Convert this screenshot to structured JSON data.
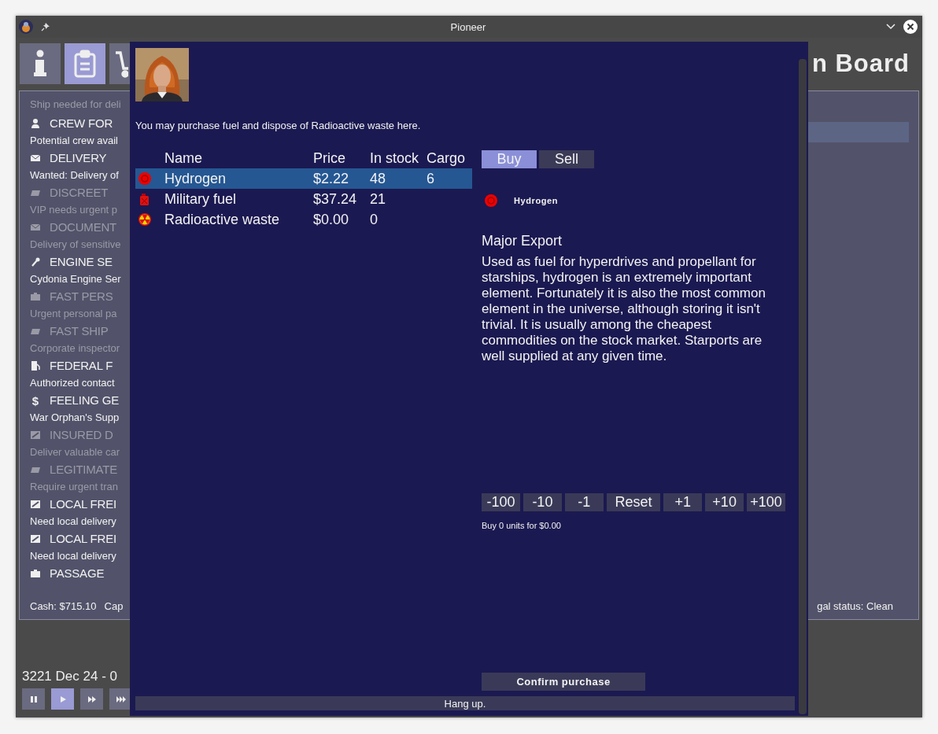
{
  "window": {
    "title": "Pioneer"
  },
  "toolbar": {
    "tabs": [
      {
        "kind": "info",
        "selected": false
      },
      {
        "kind": "clipboard",
        "selected": true
      },
      {
        "kind": "cart",
        "selected": false
      }
    ],
    "title": "n Board"
  },
  "board": {
    "intro": "Ship needed for deli",
    "items": [
      {
        "kind": "person",
        "title": "CREW FOR",
        "description": "Potential crew avail",
        "dimmed": false
      },
      {
        "kind": "mail",
        "title": "DELIVERY",
        "description": "Wanted: Delivery of",
        "dimmed": false
      },
      {
        "kind": "cargo",
        "title": "DISCREET",
        "description": "VIP needs urgent p",
        "dimmed": true
      },
      {
        "kind": "mail",
        "title": "DOCUMENT",
        "description": "Delivery of sensitive",
        "dimmed": true
      },
      {
        "kind": "wrench",
        "title": "ENGINE SE",
        "description": "Cydonia Engine Ser",
        "dimmed": false
      },
      {
        "kind": "briefcase",
        "title": "FAST PERS",
        "description": "Urgent personal pa",
        "dimmed": true
      },
      {
        "kind": "cargo",
        "title": "FAST SHIP",
        "description": "Corporate inspector",
        "dimmed": true
      },
      {
        "kind": "fuel",
        "title": "FEDERAL F",
        "description": "Authorized contact",
        "dimmed": false
      },
      {
        "kind": "glyph",
        "glyph": "$",
        "title": "FEELING GE",
        "description": "War Orphan's Supp",
        "dimmed": false
      },
      {
        "kind": "parcel",
        "title": "INSURED D",
        "description": "Deliver valuable car",
        "dimmed": true
      },
      {
        "kind": "cargo",
        "title": "LEGITIMATE",
        "description": "Require urgent tran",
        "dimmed": true
      },
      {
        "kind": "parcel",
        "title": "LOCAL FREI",
        "description": "Need local delivery",
        "dimmed": false
      },
      {
        "kind": "parcel",
        "title": "LOCAL FREI",
        "description": "Need local delivery",
        "dimmed": false
      },
      {
        "kind": "briefcase",
        "title": "PASSAGE",
        "dimmed": false
      }
    ],
    "cash": "Cash: $715.10",
    "capacity": "Cap",
    "legal_status": "gal status: Clean"
  },
  "clock": {
    "date": "3221 Dec 24 - 0",
    "controls": [
      {
        "kind": "pause",
        "selected": false
      },
      {
        "kind": "play",
        "selected": true
      },
      {
        "kind": "fast",
        "selected": false
      },
      {
        "kind": "faster",
        "selected": false
      }
    ]
  },
  "dialog": {
    "intro": "You may purchase fuel and dispose of Radioactive waste here.",
    "columns": [
      "Name",
      "Price",
      "In stock",
      "Cargo"
    ],
    "rows": [
      {
        "kind": "element",
        "name": "Hydrogen",
        "price": "$2.22",
        "stock": "48",
        "cargo": "6",
        "selected": true
      },
      {
        "kind": "can",
        "name": "Military fuel",
        "price": "$37.24",
        "stock": "21",
        "selected": false
      },
      {
        "kind": "radiation",
        "name": "Radioactive waste",
        "price": "$0.00",
        "stock": "0",
        "selected": false
      }
    ],
    "tabs": [
      {
        "label": "Buy",
        "selected": true
      },
      {
        "label": "Sell",
        "selected": false
      }
    ],
    "commodity": {
      "kind": "element",
      "name": "Hydrogen"
    },
    "heading": "Major Export",
    "description": "Used as fuel for hyperdrives and propellant for starships, hydrogen is an extremely important element. Fortunately it is also the most common element in the universe, although storing it isn't trivial. It is usually among the cheapest commodities on the stock market. Starports are well supplied at any given time.",
    "steps": [
      "-100",
      "-10",
      "-1",
      "Reset",
      "+1",
      "+10",
      "+100"
    ],
    "summary": "Buy 0 units for $0.00",
    "confirm": "Confirm purchase",
    "hang_up": "Hang up."
  }
}
